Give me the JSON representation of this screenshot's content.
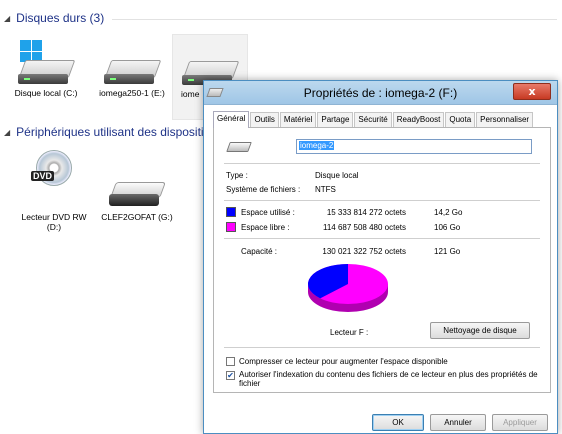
{
  "explorer": {
    "groups": [
      {
        "label": "Disques durs (3)"
      },
      {
        "label": "Périphériques utilisant des dispositifs"
      }
    ],
    "drives": [
      {
        "label": "Disque local (C:)"
      },
      {
        "label": "iomega250-1 (E:)"
      },
      {
        "label": "iome"
      }
    ],
    "devices": [
      {
        "label": "Lecteur DVD RW (D:)",
        "badge": "DVD"
      },
      {
        "label": "CLEF2GOFAT (G:)"
      }
    ]
  },
  "dialog": {
    "title": "Propriétés de : iomega-2 (F:)",
    "close_label": "x",
    "tabs": [
      "Général",
      "Outils",
      "Matériel",
      "Partage",
      "Sécurité",
      "ReadyBoost",
      "Quota",
      "Personnaliser"
    ],
    "active_tab": "Général",
    "name_value": "iomega-2",
    "type_label": "Type :",
    "type_value": "Disque local",
    "fs_label": "Système de fichiers :",
    "fs_value": "NTFS",
    "used_label": "Espace utilisé :",
    "used_bytes": "15 333 814 272 octets",
    "used_size": "14,2 Go",
    "free_label": "Espace libre :",
    "free_bytes": "114 687 508 480 octets",
    "free_size": "106 Go",
    "capacity_label": "Capacité :",
    "capacity_bytes": "130 021 322 752 octets",
    "capacity_size": "121 Go",
    "drive_label": "Lecteur F :",
    "cleanup_button": "Nettoyage de disque",
    "compress_label": "Compresser ce lecteur pour augmenter l'espace disponible",
    "compress_checked": false,
    "index_label": "Autoriser l'indexation du contenu des fichiers de ce lecteur en plus des propriétés de fichier",
    "index_checked": true,
    "ok_button": "OK",
    "cancel_button": "Annuler",
    "apply_button": "Appliquer",
    "colors": {
      "used": "#0000ff",
      "free": "#ff00ff"
    },
    "used_fraction": 0.118
  }
}
